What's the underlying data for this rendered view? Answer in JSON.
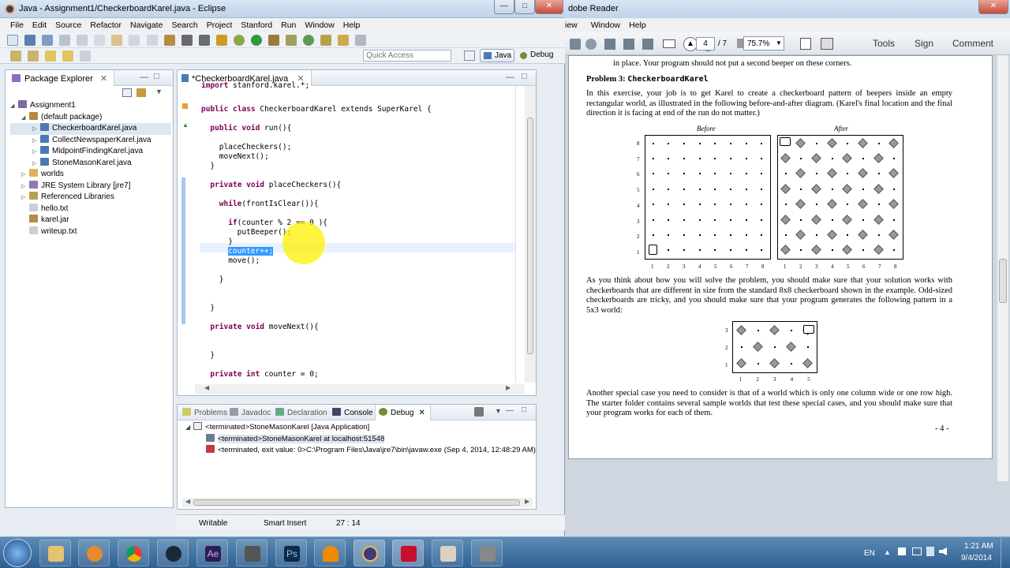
{
  "eclipse": {
    "title": "Java - Assignment1/CheckerboardKarel.java - Eclipse",
    "menu": [
      "File",
      "Edit",
      "Source",
      "Refactor",
      "Navigate",
      "Search",
      "Project",
      "Stanford",
      "Run",
      "Window",
      "Help"
    ],
    "quick_access_placeholder": "Quick Access",
    "perspectives": [
      "Java",
      "Debug"
    ],
    "package_explorer": {
      "title": "Package Explorer",
      "items": [
        {
          "label": "Assignment1",
          "level": 0
        },
        {
          "label": "(default package)",
          "level": 1
        },
        {
          "label": "CheckerboardKarel.java",
          "level": 2
        },
        {
          "label": "CollectNewspaperKarel.java",
          "level": 2
        },
        {
          "label": "MidpointFindingKarel.java",
          "level": 2
        },
        {
          "label": "StoneMasonKarel.java",
          "level": 2
        },
        {
          "label": "worlds",
          "level": 1
        },
        {
          "label": "JRE System Library [jre7]",
          "level": 1
        },
        {
          "label": "Referenced Libraries",
          "level": 1
        },
        {
          "label": "hello.txt",
          "level": 1
        },
        {
          "label": "karel.jar",
          "level": 1
        },
        {
          "label": "writeup.txt",
          "level": 1
        }
      ]
    },
    "editor": {
      "tab": "*CheckerboardKarel.java",
      "lines": [
        {
          "indent": 0,
          "kw": "import",
          "text": " stanford.karel.*;"
        },
        {
          "indent": 0,
          "kw": "public class",
          "text": " CheckerboardKarel extends SuperKarel {"
        },
        {
          "indent": 2,
          "kw": "public void",
          "text": " run(){"
        },
        {
          "indent": 4,
          "kw": "",
          "text": "placeCheckers();"
        },
        {
          "indent": 4,
          "kw": "",
          "text": "moveNext();"
        },
        {
          "indent": 2,
          "kw": "",
          "text": "}"
        },
        {
          "indent": 2,
          "kw": "private void",
          "text": " placeCheckers(){"
        },
        {
          "indent": 4,
          "kw": "while",
          "text": "(frontIsClear()){"
        },
        {
          "indent": 6,
          "kw": "if",
          "text": "(counter % 2 == 0 ){"
        },
        {
          "indent": 8,
          "kw": "",
          "text": "putBeeper();"
        },
        {
          "indent": 6,
          "kw": "",
          "text": "}"
        },
        {
          "indent": 6,
          "kw": "",
          "text": "counter++;"
        },
        {
          "indent": 6,
          "kw": "",
          "text": "move();"
        },
        {
          "indent": 4,
          "kw": "",
          "text": "}"
        },
        {
          "indent": 2,
          "kw": "",
          "text": "}"
        },
        {
          "indent": 2,
          "kw": "private void",
          "text": " moveNext(){"
        },
        {
          "indent": 2,
          "kw": "",
          "text": "}"
        },
        {
          "indent": 2,
          "kw": "private int",
          "text": " counter = 0;"
        }
      ]
    },
    "bottom_tabs": [
      "Problems",
      "Javadoc",
      "Declaration",
      "Console",
      "Debug"
    ],
    "debug_items": [
      "<terminated>StoneMasonKarel [Java Application]",
      "<terminated>StoneMasonKarel at localhost:51548",
      "<terminated, exit value: 0>C:\\Program Files\\Java\\jre7\\bin\\javaw.exe (Sep 4, 2014, 12:48:29 AM)"
    ],
    "status": {
      "mode": "Writable",
      "insert": "Smart Insert",
      "position": "27 : 14"
    }
  },
  "adobe": {
    "title": "dobe Reader",
    "menu": [
      "iew",
      "Window",
      "Help"
    ],
    "page_current": "4",
    "page_total": "/ 7",
    "zoom": "75.7%",
    "tools": [
      "Tools",
      "Sign",
      "Comment"
    ],
    "doc": {
      "top_fragment": "in place. Your program should not put a second beeper on these corners.",
      "heading": "Problem 3: ",
      "heading_code": "CheckerboardKarel",
      "para1": "In this exercise, your job is to get Karel to create a checkerboard pattern of beepers inside an empty rectangular world, as illustrated in the following before-and-after diagram. (Karel's final location and the final direction it is facing at end of the run do not matter.)",
      "before_label": "Before",
      "after_label": "After",
      "row_labels": [
        "8",
        "7",
        "6",
        "5",
        "4",
        "3",
        "2",
        "1"
      ],
      "col_labels": [
        "1",
        "2",
        "3",
        "4",
        "5",
        "6",
        "7",
        "8"
      ],
      "para2": "As you think about how you will solve the problem, you should make sure that your solution works with checkerboards that are different in size from the standard 8x8 checkerboard shown in the example. Odd-sized checkerboards are tricky, and you should make sure that your program generates the following pattern in a 5x3 world:",
      "small_rows": [
        "3",
        "2",
        "1"
      ],
      "small_cols": [
        "1",
        "2",
        "3",
        "4",
        "5"
      ],
      "para3": "Another special case you need to consider is that of a world which is only one column wide or one row high. The starter folder contains several sample worlds that test these special cases, and you should make sure that your program works for each of them.",
      "page_number": "- 4 -"
    }
  },
  "taskbar": {
    "lang": "EN",
    "time": "1:21 AM",
    "date": "9/4/2014",
    "apps": [
      "start",
      "explorer",
      "media-player",
      "chrome",
      "steam",
      "after-effects",
      "film",
      "photoshop",
      "vlc",
      "eclipse",
      "acrobat",
      "paint",
      "karel"
    ]
  }
}
